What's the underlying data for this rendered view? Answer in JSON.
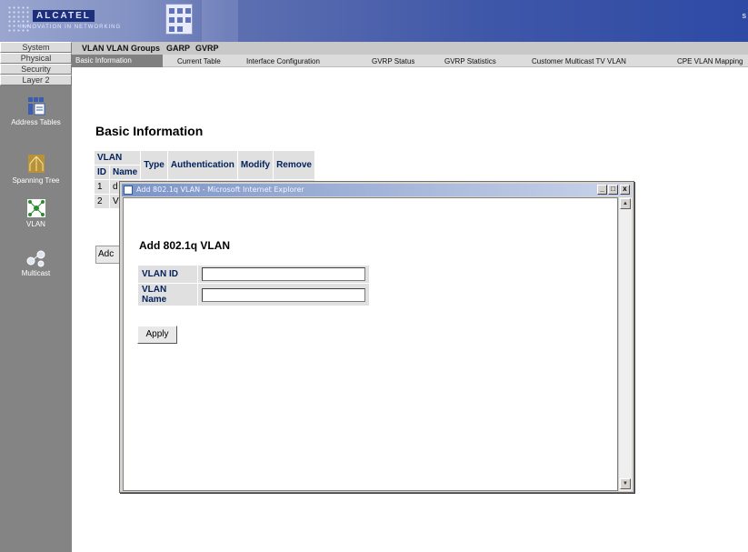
{
  "banner": {
    "logo": "ALCATEL",
    "tagline": "INNOVATION IN NETWORKING"
  },
  "leftnav": {
    "buttons": [
      "System",
      "Physical",
      "Security",
      "Layer 2"
    ],
    "icons": [
      {
        "label": "Address Tables",
        "icon": "address-tables-icon"
      },
      {
        "label": "Spanning Tree",
        "icon": "spanning-tree-icon"
      },
      {
        "label": "VLAN",
        "icon": "vlan-icon"
      },
      {
        "label": "Multicast",
        "icon": "multicast-icon"
      }
    ]
  },
  "tabs": {
    "primary": [
      "VLAN",
      "VLAN Groups",
      "GARP",
      "GVRP"
    ],
    "secondary": [
      "Basic Information",
      "Current Table",
      "Interface Configuration",
      "GVRP Status",
      "GVRP Statistics",
      "Customer Multicast TV VLAN",
      "CPE VLAN Mapping"
    ]
  },
  "main": {
    "title": "Basic Information",
    "table": {
      "group_header": "VLAN",
      "headers": [
        "Type",
        "Authentication",
        "Modify",
        "Remove"
      ],
      "sub_headers": [
        "ID",
        "Name"
      ],
      "rows": [
        {
          "id": "1",
          "name": "d"
        },
        {
          "id": "2",
          "name": "V"
        }
      ]
    },
    "add_button": "Adc"
  },
  "popup": {
    "window_title": "Add 802.1q VLAN - Microsoft Internet Explorer",
    "heading": "Add 802.1q VLAN",
    "fields": [
      {
        "label": "VLAN ID",
        "value": ""
      },
      {
        "label": "VLAN Name",
        "value": ""
      }
    ],
    "apply_label": "Apply",
    "controls": {
      "minimize": "_",
      "maximize": "□",
      "close": "x"
    }
  },
  "colors": {
    "banner": "#3f57a8",
    "nav_bg": "#848484",
    "label_blue": "#00205b",
    "popup_frame": "#d6d3ce"
  }
}
